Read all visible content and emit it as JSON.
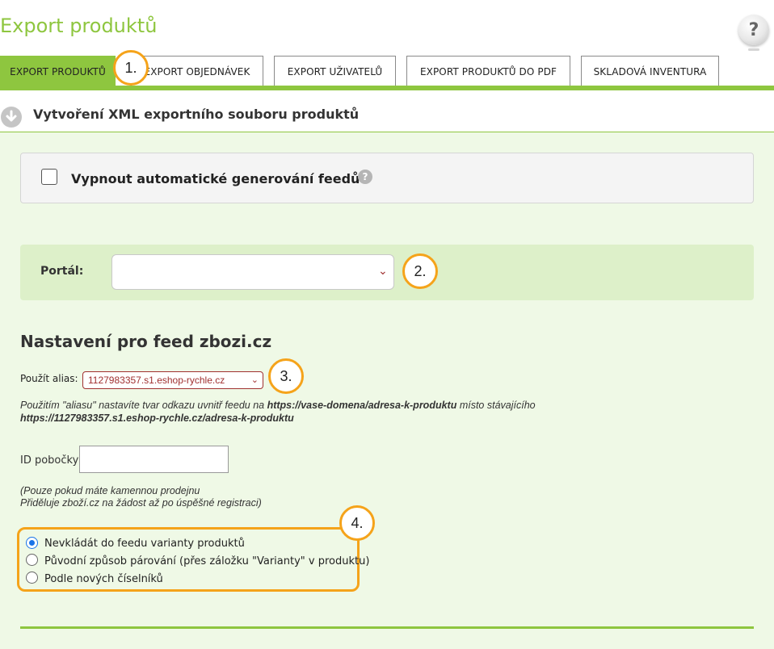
{
  "page": {
    "title": "Export produktů",
    "help": "?"
  },
  "tabs": [
    {
      "label": "EXPORT PRODUKTŮ",
      "active": true
    },
    {
      "label": "EXPORT OBJEDNÁVEK"
    },
    {
      "label": "EXPORT UŽIVATELŮ"
    },
    {
      "label": "EXPORT PRODUKTŮ DO PDF"
    },
    {
      "label": "SKLADOVÁ INVENTURA"
    }
  ],
  "section": {
    "title": "Vytvoření XML exportního souboru produktů"
  },
  "auto_feed": {
    "label": "Vypnout automatické generování feedů",
    "checked": false,
    "help": "?"
  },
  "portal": {
    "label": "Portál:",
    "value": ""
  },
  "feed": {
    "heading": "Nastavení pro feed zbozi.cz",
    "alias_label": "Použít alias:",
    "alias_value": "1127983357.s1.eshop-rychle.cz",
    "note_1": "Použitím \"aliasu\" nastavíte tvar odkazu uvnitř feedu na",
    "note_link_1": "https://vase-domena/adresa-k-produktu",
    "note_2": "místo stávajícího",
    "note_link_2": "https://1127983357.s1.eshop-rychle.cz/adresa-k-produktu",
    "id_label": "ID pobočky",
    "id_value": "",
    "id_note_1": "(Pouze pokud máte kamennou prodejnu",
    "id_note_2": "Přiděluje zboží.cz na žádost až po úspěšné registraci)"
  },
  "variants": [
    {
      "label": "Nevkládát do feedu varianty produktů",
      "checked": true
    },
    {
      "label": "Původní způsob párování (přes záložku \"Varianty\" v produktu)",
      "checked": false
    },
    {
      "label": "Podle nových číselníků",
      "checked": false
    }
  ],
  "badges": [
    "1.",
    "2.",
    "3.",
    "4."
  ],
  "colors": {
    "accent": "#8ec63f",
    "highlight": "#f5a31a",
    "panel": "#ddf0c9"
  }
}
